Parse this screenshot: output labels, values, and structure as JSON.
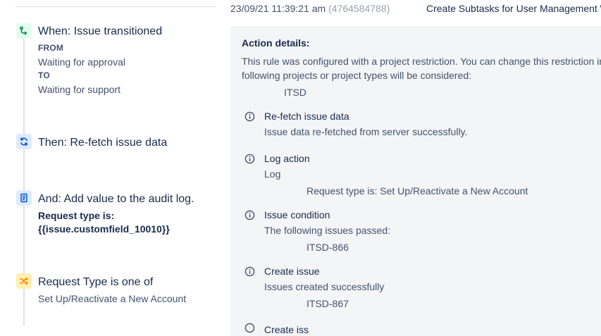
{
  "steps": {
    "trigger": {
      "title": "When: Issue transitioned",
      "from_label": "FROM",
      "from_value": "Waiting for approval",
      "to_label": "TO",
      "to_value": "Waiting for support",
      "icon": "trigger-branch-icon"
    },
    "refetch": {
      "title": "Then: Re-fetch issue data",
      "icon": "refresh-icon"
    },
    "audit": {
      "title": "And: Add value to the audit log.",
      "line1": "Request type is:",
      "line2": "{{issue.customfield_10010}}",
      "icon": "audit-log-icon"
    },
    "condition": {
      "title": "Request Type is one of",
      "value": "Set Up/Reactivate a New Account",
      "icon": "shuffle-icon"
    }
  },
  "log_entry": {
    "timestamp": "23/09/21 11:39:21 am",
    "execution_id": "(4764584788)",
    "rule_name": "Create Subtasks for User Management W"
  },
  "details": {
    "heading": "Action details:",
    "restriction_line1": "This rule was configured with a project restriction. You can change this restriction in",
    "restriction_line2": "following projects or project types will be considered:",
    "project": "ITSD",
    "actions": [
      {
        "title": "Re-fetch issue data",
        "description": "Issue data re-fetched from server successfully.",
        "sub": ""
      },
      {
        "title": "Log action",
        "description": "Log",
        "sub": "Request type is: Set Up/Reactivate a New Account"
      },
      {
        "title": "Issue condition",
        "description": "The following issues passed:",
        "sub": "ITSD-866"
      },
      {
        "title": "Create issue",
        "description": "Issues created successfully",
        "sub": "ITSD-867"
      }
    ],
    "next_partial": "Create iss"
  },
  "colors": {
    "text_primary": "#172b4d",
    "text_secondary": "#42526e",
    "muted": "#97a0af",
    "panel_bg": "#f4f5f7",
    "trigger_green": "#00875a",
    "action_blue": "#0052cc",
    "condition_yellow": "#ff8b00"
  }
}
